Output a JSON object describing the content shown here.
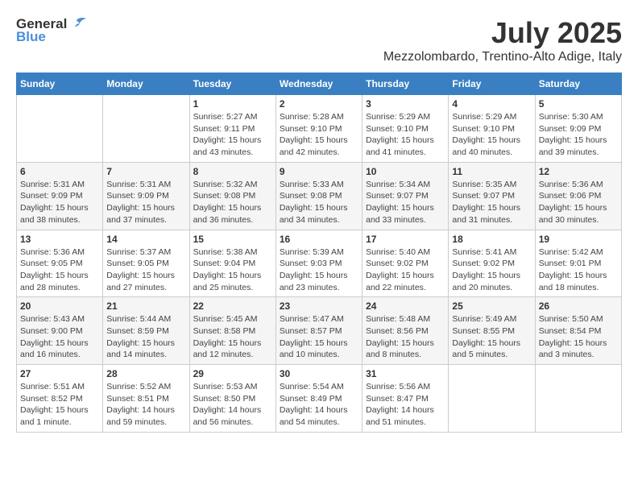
{
  "header": {
    "logo_general": "General",
    "logo_blue": "Blue",
    "month_title": "July 2025",
    "subtitle": "Mezzolombardo, Trentino-Alto Adige, Italy"
  },
  "weekdays": [
    "Sunday",
    "Monday",
    "Tuesday",
    "Wednesday",
    "Thursday",
    "Friday",
    "Saturday"
  ],
  "weeks": [
    [
      {
        "day": "",
        "info": ""
      },
      {
        "day": "",
        "info": ""
      },
      {
        "day": "1",
        "info": "Sunrise: 5:27 AM\nSunset: 9:11 PM\nDaylight: 15 hours and 43 minutes."
      },
      {
        "day": "2",
        "info": "Sunrise: 5:28 AM\nSunset: 9:10 PM\nDaylight: 15 hours and 42 minutes."
      },
      {
        "day": "3",
        "info": "Sunrise: 5:29 AM\nSunset: 9:10 PM\nDaylight: 15 hours and 41 minutes."
      },
      {
        "day": "4",
        "info": "Sunrise: 5:29 AM\nSunset: 9:10 PM\nDaylight: 15 hours and 40 minutes."
      },
      {
        "day": "5",
        "info": "Sunrise: 5:30 AM\nSunset: 9:09 PM\nDaylight: 15 hours and 39 minutes."
      }
    ],
    [
      {
        "day": "6",
        "info": "Sunrise: 5:31 AM\nSunset: 9:09 PM\nDaylight: 15 hours and 38 minutes."
      },
      {
        "day": "7",
        "info": "Sunrise: 5:31 AM\nSunset: 9:09 PM\nDaylight: 15 hours and 37 minutes."
      },
      {
        "day": "8",
        "info": "Sunrise: 5:32 AM\nSunset: 9:08 PM\nDaylight: 15 hours and 36 minutes."
      },
      {
        "day": "9",
        "info": "Sunrise: 5:33 AM\nSunset: 9:08 PM\nDaylight: 15 hours and 34 minutes."
      },
      {
        "day": "10",
        "info": "Sunrise: 5:34 AM\nSunset: 9:07 PM\nDaylight: 15 hours and 33 minutes."
      },
      {
        "day": "11",
        "info": "Sunrise: 5:35 AM\nSunset: 9:07 PM\nDaylight: 15 hours and 31 minutes."
      },
      {
        "day": "12",
        "info": "Sunrise: 5:36 AM\nSunset: 9:06 PM\nDaylight: 15 hours and 30 minutes."
      }
    ],
    [
      {
        "day": "13",
        "info": "Sunrise: 5:36 AM\nSunset: 9:05 PM\nDaylight: 15 hours and 28 minutes."
      },
      {
        "day": "14",
        "info": "Sunrise: 5:37 AM\nSunset: 9:05 PM\nDaylight: 15 hours and 27 minutes."
      },
      {
        "day": "15",
        "info": "Sunrise: 5:38 AM\nSunset: 9:04 PM\nDaylight: 15 hours and 25 minutes."
      },
      {
        "day": "16",
        "info": "Sunrise: 5:39 AM\nSunset: 9:03 PM\nDaylight: 15 hours and 23 minutes."
      },
      {
        "day": "17",
        "info": "Sunrise: 5:40 AM\nSunset: 9:02 PM\nDaylight: 15 hours and 22 minutes."
      },
      {
        "day": "18",
        "info": "Sunrise: 5:41 AM\nSunset: 9:02 PM\nDaylight: 15 hours and 20 minutes."
      },
      {
        "day": "19",
        "info": "Sunrise: 5:42 AM\nSunset: 9:01 PM\nDaylight: 15 hours and 18 minutes."
      }
    ],
    [
      {
        "day": "20",
        "info": "Sunrise: 5:43 AM\nSunset: 9:00 PM\nDaylight: 15 hours and 16 minutes."
      },
      {
        "day": "21",
        "info": "Sunrise: 5:44 AM\nSunset: 8:59 PM\nDaylight: 15 hours and 14 minutes."
      },
      {
        "day": "22",
        "info": "Sunrise: 5:45 AM\nSunset: 8:58 PM\nDaylight: 15 hours and 12 minutes."
      },
      {
        "day": "23",
        "info": "Sunrise: 5:47 AM\nSunset: 8:57 PM\nDaylight: 15 hours and 10 minutes."
      },
      {
        "day": "24",
        "info": "Sunrise: 5:48 AM\nSunset: 8:56 PM\nDaylight: 15 hours and 8 minutes."
      },
      {
        "day": "25",
        "info": "Sunrise: 5:49 AM\nSunset: 8:55 PM\nDaylight: 15 hours and 5 minutes."
      },
      {
        "day": "26",
        "info": "Sunrise: 5:50 AM\nSunset: 8:54 PM\nDaylight: 15 hours and 3 minutes."
      }
    ],
    [
      {
        "day": "27",
        "info": "Sunrise: 5:51 AM\nSunset: 8:52 PM\nDaylight: 15 hours and 1 minute."
      },
      {
        "day": "28",
        "info": "Sunrise: 5:52 AM\nSunset: 8:51 PM\nDaylight: 14 hours and 59 minutes."
      },
      {
        "day": "29",
        "info": "Sunrise: 5:53 AM\nSunset: 8:50 PM\nDaylight: 14 hours and 56 minutes."
      },
      {
        "day": "30",
        "info": "Sunrise: 5:54 AM\nSunset: 8:49 PM\nDaylight: 14 hours and 54 minutes."
      },
      {
        "day": "31",
        "info": "Sunrise: 5:56 AM\nSunset: 8:47 PM\nDaylight: 14 hours and 51 minutes."
      },
      {
        "day": "",
        "info": ""
      },
      {
        "day": "",
        "info": ""
      }
    ]
  ]
}
